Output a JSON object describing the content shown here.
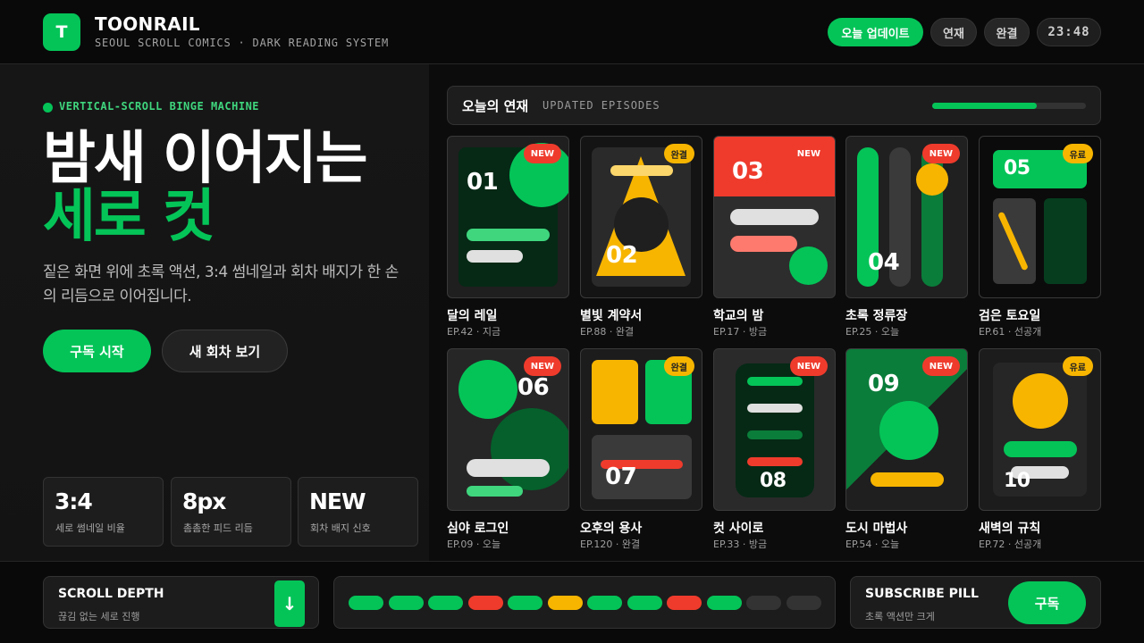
{
  "header": {
    "logo_letter": "T",
    "brand": "TOONRAIL",
    "brand_sub": "SEOUL SCROLL COMICS · DARK READING SYSTEM",
    "pills": {
      "today": "오늘 업데이트",
      "serial": "연재",
      "done": "완결"
    },
    "time": "23:48"
  },
  "hero": {
    "tag": "VERTICAL-SCROLL BINGE MACHINE",
    "headline_1": "밤새 이어지는",
    "headline_2": "세로 컷",
    "description": "짙은 화면 위에 초록 액션, 3:4 썸네일과 회차 배지가 한 손의 리듬으로 이어집니다.",
    "primary_button": "구독 시작",
    "secondary_button": "새 회차 보기",
    "stats": [
      {
        "value": "3:4",
        "label": "세로 썸네일 비율"
      },
      {
        "value": "8px",
        "label": "촘촘한 피드 리듬"
      },
      {
        "value": "NEW",
        "label": "회차 배지 신호"
      }
    ]
  },
  "section": {
    "title": "오늘의 연재",
    "subtitle": "UPDATED EPISODES",
    "progress": 0.68
  },
  "cards": [
    {
      "num": "01",
      "badge": "NEW",
      "title": "달의 레일",
      "meta": "EP.42 · 지금"
    },
    {
      "num": "02",
      "badge": "완결",
      "title": "별빛 계약서",
      "meta": "EP.88 · 완결"
    },
    {
      "num": "03",
      "badge": "NEW",
      "title": "학교의 밤",
      "meta": "EP.17 · 방금"
    },
    {
      "num": "04",
      "badge": "NEW",
      "title": "초록 정류장",
      "meta": "EP.25 · 오늘"
    },
    {
      "num": "05",
      "badge": "유료",
      "title": "검은 토요일",
      "meta": "EP.61 · 선공개"
    },
    {
      "num": "06",
      "badge": "NEW",
      "title": "심야 로그인",
      "meta": "EP.09 · 오늘"
    },
    {
      "num": "07",
      "badge": "완결",
      "title": "오후의 용사",
      "meta": "EP.120 · 완결"
    },
    {
      "num": "08",
      "badge": "NEW",
      "title": "컷 사이로",
      "meta": "EP.33 · 방금"
    },
    {
      "num": "09",
      "badge": "NEW",
      "title": "도시 마법사",
      "meta": "EP.54 · 오늘"
    },
    {
      "num": "10",
      "badge": "유료",
      "title": "새벽의 규칙",
      "meta": "EP.72 · 선공개"
    }
  ],
  "footer": {
    "scroll_title": "SCROLL DEPTH",
    "scroll_sub": "끊김 없는 세로 진행",
    "arrow": "↓",
    "segments": [
      "green",
      "green",
      "green",
      "red",
      "green",
      "yellow",
      "green",
      "green",
      "red",
      "green",
      "dark",
      "dark"
    ],
    "subscribe_title": "SUBSCRIBE PILL",
    "subscribe_sub": "초록 액션만 크게",
    "subscribe_button": "구독"
  },
  "colors": {
    "accent": "#04c458",
    "red": "#ef3b2c",
    "yellow": "#f7b500",
    "bg": "#0c0c0c"
  }
}
